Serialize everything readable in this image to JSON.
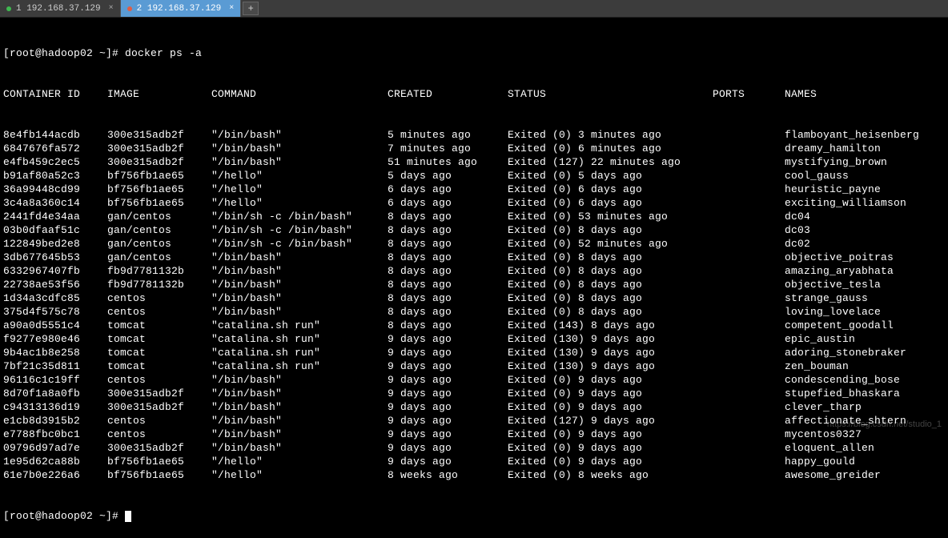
{
  "tabs": [
    {
      "label": "1 192.168.37.129",
      "active": false,
      "dot": "green"
    },
    {
      "label": "2 192.168.37.129",
      "active": true,
      "dot": "red"
    }
  ],
  "tab_add_glyph": "+",
  "tab_close_glyph": "×",
  "prompt1": "[root@hadoop02 ~]# docker ps -a",
  "prompt2": "[root@hadoop02 ~]# ",
  "headers": {
    "id": "CONTAINER ID",
    "image": "IMAGE",
    "command": "COMMAND",
    "created": "CREATED",
    "status": "STATUS",
    "ports": "PORTS",
    "names": "NAMES"
  },
  "rows": [
    {
      "id": "8e4fb144acdb",
      "image": "300e315adb2f",
      "command": "\"/bin/bash\"",
      "created": "5 minutes ago",
      "status": "Exited (0) 3 minutes ago",
      "ports": "",
      "names": "flamboyant_heisenberg"
    },
    {
      "id": "6847676fa572",
      "image": "300e315adb2f",
      "command": "\"/bin/bash\"",
      "created": "7 minutes ago",
      "status": "Exited (0) 6 minutes ago",
      "ports": "",
      "names": "dreamy_hamilton"
    },
    {
      "id": "e4fb459c2ec5",
      "image": "300e315adb2f",
      "command": "\"/bin/bash\"",
      "created": "51 minutes ago",
      "status": "Exited (127) 22 minutes ago",
      "ports": "",
      "names": "mystifying_brown"
    },
    {
      "id": "b91af80a52c3",
      "image": "bf756fb1ae65",
      "command": "\"/hello\"",
      "created": "5 days ago",
      "status": "Exited (0) 5 days ago",
      "ports": "",
      "names": "cool_gauss"
    },
    {
      "id": "36a99448cd99",
      "image": "bf756fb1ae65",
      "command": "\"/hello\"",
      "created": "6 days ago",
      "status": "Exited (0) 6 days ago",
      "ports": "",
      "names": "heuristic_payne"
    },
    {
      "id": "3c4a8a360c14",
      "image": "bf756fb1ae65",
      "command": "\"/hello\"",
      "created": "6 days ago",
      "status": "Exited (0) 6 days ago",
      "ports": "",
      "names": "exciting_williamson"
    },
    {
      "id": "2441fd4e34aa",
      "image": "gan/centos",
      "command": "\"/bin/sh -c /bin/bash\"",
      "created": "8 days ago",
      "status": "Exited (0) 53 minutes ago",
      "ports": "",
      "names": "dc04"
    },
    {
      "id": "03b0dfaaf51c",
      "image": "gan/centos",
      "command": "\"/bin/sh -c /bin/bash\"",
      "created": "8 days ago",
      "status": "Exited (0) 8 days ago",
      "ports": "",
      "names": "dc03"
    },
    {
      "id": "122849bed2e8",
      "image": "gan/centos",
      "command": "\"/bin/sh -c /bin/bash\"",
      "created": "8 days ago",
      "status": "Exited (0) 52 minutes ago",
      "ports": "",
      "names": "dc02"
    },
    {
      "id": "3db677645b53",
      "image": "gan/centos",
      "command": "\"/bin/bash\"",
      "created": "8 days ago",
      "status": "Exited (0) 8 days ago",
      "ports": "",
      "names": "objective_poitras"
    },
    {
      "id": "6332967407fb",
      "image": "fb9d7781132b",
      "command": "\"/bin/bash\"",
      "created": "8 days ago",
      "status": "Exited (0) 8 days ago",
      "ports": "",
      "names": "amazing_aryabhata"
    },
    {
      "id": "22738ae53f56",
      "image": "fb9d7781132b",
      "command": "\"/bin/bash\"",
      "created": "8 days ago",
      "status": "Exited (0) 8 days ago",
      "ports": "",
      "names": "objective_tesla"
    },
    {
      "id": "1d34a3cdfc85",
      "image": "centos",
      "command": "\"/bin/bash\"",
      "created": "8 days ago",
      "status": "Exited (0) 8 days ago",
      "ports": "",
      "names": "strange_gauss"
    },
    {
      "id": "375d4f575c78",
      "image": "centos",
      "command": "\"/bin/bash\"",
      "created": "8 days ago",
      "status": "Exited (0) 8 days ago",
      "ports": "",
      "names": "loving_lovelace"
    },
    {
      "id": "a90a0d5551c4",
      "image": "tomcat",
      "command": "\"catalina.sh run\"",
      "created": "8 days ago",
      "status": "Exited (143) 8 days ago",
      "ports": "",
      "names": "competent_goodall"
    },
    {
      "id": "f9277e980e46",
      "image": "tomcat",
      "command": "\"catalina.sh run\"",
      "created": "9 days ago",
      "status": "Exited (130) 9 days ago",
      "ports": "",
      "names": "epic_austin"
    },
    {
      "id": "9b4ac1b8e258",
      "image": "tomcat",
      "command": "\"catalina.sh run\"",
      "created": "9 days ago",
      "status": "Exited (130) 9 days ago",
      "ports": "",
      "names": "adoring_stonebraker"
    },
    {
      "id": "7bf21c35d811",
      "image": "tomcat",
      "command": "\"catalina.sh run\"",
      "created": "9 days ago",
      "status": "Exited (130) 9 days ago",
      "ports": "",
      "names": "zen_bouman"
    },
    {
      "id": "96116c1c19ff",
      "image": "centos",
      "command": "\"/bin/bash\"",
      "created": "9 days ago",
      "status": "Exited (0) 9 days ago",
      "ports": "",
      "names": "condescending_bose"
    },
    {
      "id": "8d70f1a8a0fb",
      "image": "300e315adb2f",
      "command": "\"/bin/bash\"",
      "created": "9 days ago",
      "status": "Exited (0) 9 days ago",
      "ports": "",
      "names": "stupefied_bhaskara"
    },
    {
      "id": "c94313136d19",
      "image": "300e315adb2f",
      "command": "\"/bin/bash\"",
      "created": "9 days ago",
      "status": "Exited (0) 9 days ago",
      "ports": "",
      "names": "clever_tharp"
    },
    {
      "id": "e1cb8d3915b2",
      "image": "centos",
      "command": "\"/bin/bash\"",
      "created": "9 days ago",
      "status": "Exited (127) 9 days ago",
      "ports": "",
      "names": "affectionate_shtern"
    },
    {
      "id": "e7788fbc0bc1",
      "image": "centos",
      "command": "\"/bin/bash\"",
      "created": "9 days ago",
      "status": "Exited (0) 9 days ago",
      "ports": "",
      "names": "mycentos0327"
    },
    {
      "id": "09796d97ad7e",
      "image": "300e315adb2f",
      "command": "\"/bin/bash\"",
      "created": "9 days ago",
      "status": "Exited (0) 9 days ago",
      "ports": "",
      "names": "eloquent_allen"
    },
    {
      "id": "1e95d62ca88b",
      "image": "bf756fb1ae65",
      "command": "\"/hello\"",
      "created": "9 days ago",
      "status": "Exited (0) 9 days ago",
      "ports": "",
      "names": "happy_gould"
    },
    {
      "id": "61e7b0e226a6",
      "image": "bf756fb1ae65",
      "command": "\"/hello\"",
      "created": "8 weeks ago",
      "status": "Exited (0) 8 weeks ago",
      "ports": "",
      "names": "awesome_greider"
    }
  ],
  "watermark": "https://blog.csdn.net/studio_1"
}
